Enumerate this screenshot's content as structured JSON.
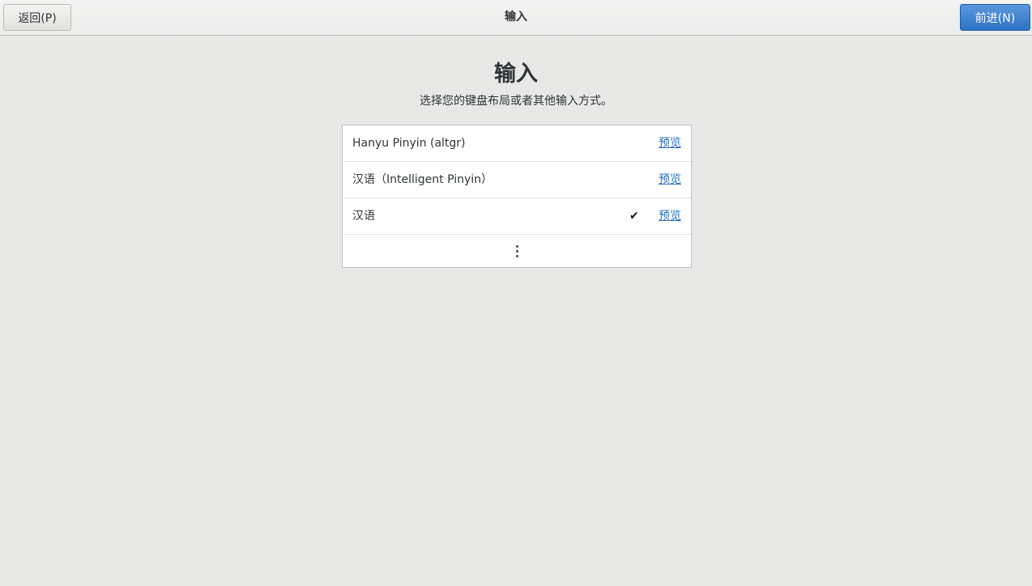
{
  "header": {
    "back_label": "返回(P)",
    "title": "输入",
    "next_label": "前进(N)"
  },
  "main": {
    "title": "输入",
    "subtitle": "选择您的键盘布局或者其他输入方式。"
  },
  "input_sources": [
    {
      "label": "Hanyu Pinyin (altgr)",
      "preview": "预览",
      "selected": false
    },
    {
      "label": "汉语（Intelligent Pinyin）",
      "preview": "预览",
      "selected": false
    },
    {
      "label": "汉语",
      "preview": "预览",
      "selected": true
    }
  ],
  "icons": {
    "selected": "checkmark-icon",
    "more": "more-vertical-icon"
  },
  "colors": {
    "accent": "#3a7fd0",
    "link": "#2a6fb8",
    "background": "#e8e8e7"
  }
}
